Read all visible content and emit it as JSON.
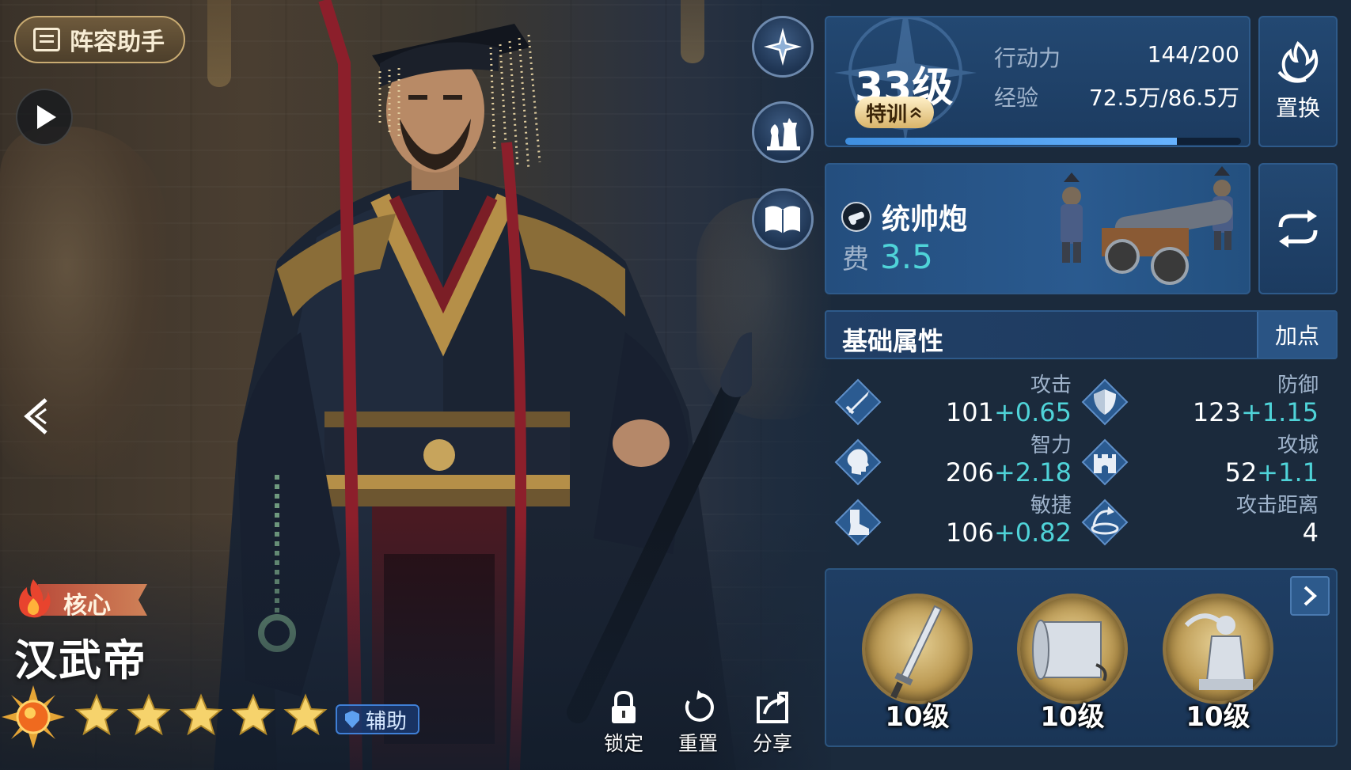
{
  "top_left": {
    "lineup_label": "阵容助手"
  },
  "hero": {
    "tag": "核心",
    "name": "汉武帝",
    "stars": 5,
    "role": "辅助"
  },
  "actions": [
    {
      "label": "锁定",
      "icon": "lock-icon"
    },
    {
      "label": "重置",
      "icon": "reset-icon"
    },
    {
      "label": "分享",
      "icon": "share-icon"
    }
  ],
  "side_buttons": [
    "compass-icon",
    "chess-icon",
    "book-icon"
  ],
  "level_card": {
    "level": "33级",
    "special_label": "特训",
    "action_label": "行动力",
    "action_value": "144/200",
    "exp_label": "经验",
    "exp_value": "72.5万/86.5万",
    "exp_progress": 0.838
  },
  "swap": {
    "label": "置换"
  },
  "troop": {
    "name": "统帅炮",
    "cost_label": "费",
    "cost_value": "3.5"
  },
  "attributes": {
    "title": "基础属性",
    "add_label": "加点",
    "items": [
      {
        "name": "攻击",
        "base": "101",
        "bonus": "+0.65",
        "icon": "sword-icon"
      },
      {
        "name": "防御",
        "base": "123",
        "bonus": "+1.15",
        "icon": "shield-icon"
      },
      {
        "name": "智力",
        "base": "206",
        "bonus": "+2.18",
        "icon": "head-icon"
      },
      {
        "name": "攻城",
        "base": "52",
        "bonus": "+1.1",
        "icon": "castle-icon"
      },
      {
        "name": "敏捷",
        "base": "106",
        "bonus": "+0.82",
        "icon": "boot-icon"
      },
      {
        "name": "攻击距离",
        "base": "4",
        "bonus": "",
        "icon": "range-icon"
      }
    ]
  },
  "equipment": [
    {
      "level": "10级",
      "icon": "sword-icon"
    },
    {
      "level": "10级",
      "icon": "scroll-icon"
    },
    {
      "level": "10级",
      "icon": "warrior-statue-icon"
    }
  ],
  "colors": {
    "accent_cyan": "#4fd3d8",
    "panel_blue": "#234872",
    "gold": "#d9b46a"
  }
}
